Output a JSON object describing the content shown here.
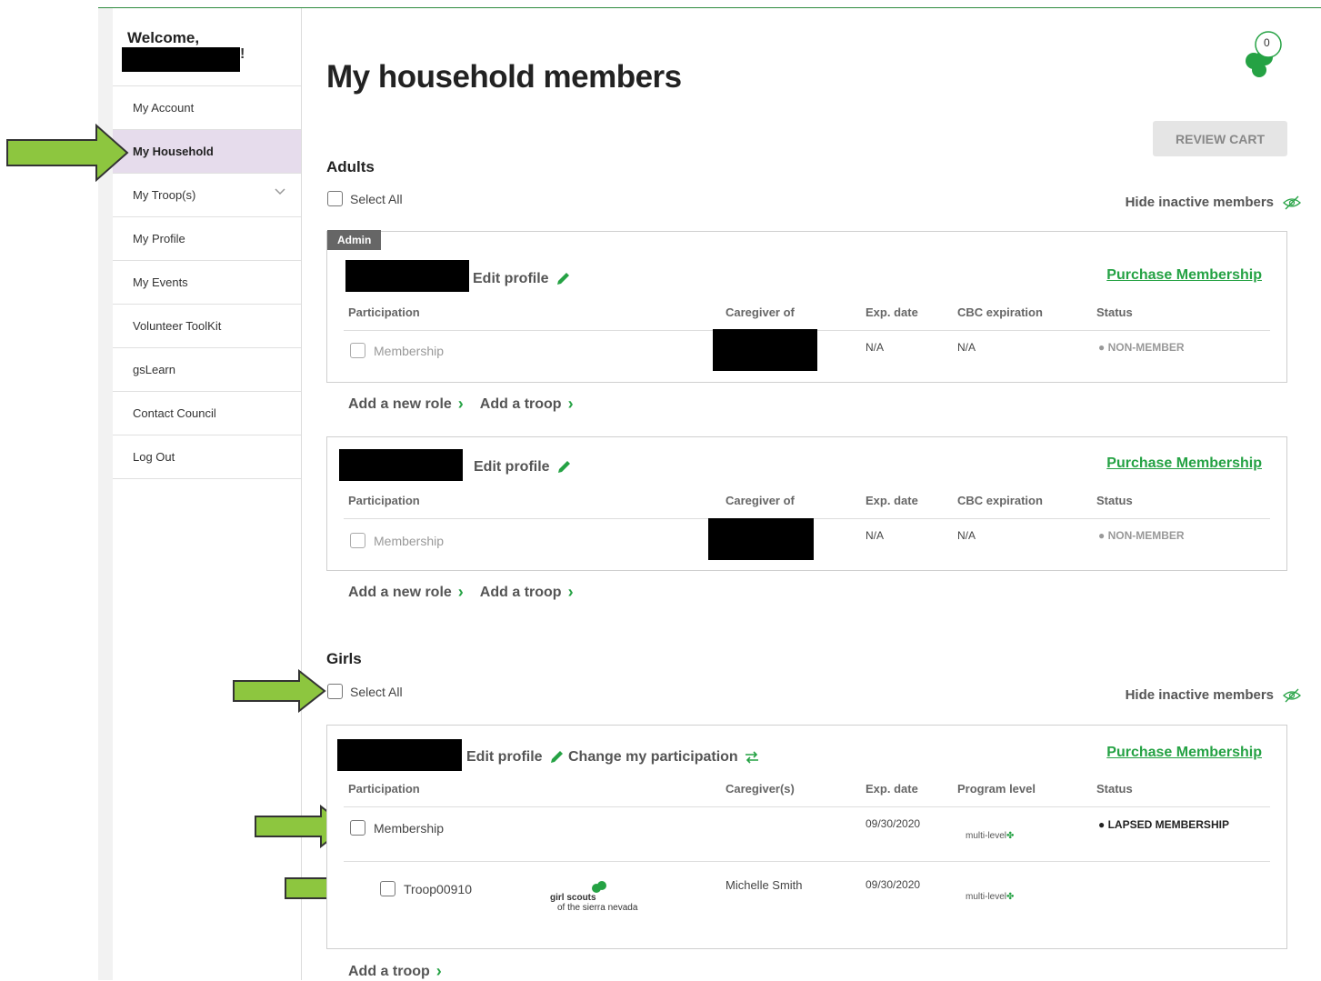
{
  "sidebar": {
    "welcome": "Welcome,",
    "welcome_suffix": "!",
    "items": [
      {
        "label": "My Account"
      },
      {
        "label": "My Household"
      },
      {
        "label": "My Troop(s)"
      },
      {
        "label": "My Profile"
      },
      {
        "label": "My Events"
      },
      {
        "label": "Volunteer ToolKit"
      },
      {
        "label": "gsLearn"
      },
      {
        "label": "Contact Council"
      },
      {
        "label": "Log Out"
      }
    ]
  },
  "header": {
    "title": "My household members",
    "cart_count": "0",
    "review_cart": "REVIEW CART"
  },
  "colors": {
    "accent": "#25a244",
    "arrow": "#8dc63f",
    "active_nav": "#e6dcec"
  },
  "adults": {
    "title": "Adults",
    "select_all": "Select All",
    "hide_inactive": "Hide inactive members",
    "admin_tag": "Admin",
    "cards": [
      {
        "edit_profile": "Edit profile",
        "purchase": "Purchase Membership",
        "headers": [
          "Participation",
          "Caregiver of",
          "Exp. date",
          "CBC expiration",
          "Status"
        ],
        "row": {
          "participation": "Membership",
          "exp": "N/A",
          "cbc": "N/A",
          "status": "NON-MEMBER"
        },
        "add_role": "Add a new role",
        "add_troop": "Add a troop"
      },
      {
        "edit_profile": "Edit profile",
        "purchase": "Purchase Membership",
        "headers": [
          "Participation",
          "Caregiver of",
          "Exp. date",
          "CBC expiration",
          "Status"
        ],
        "row": {
          "participation": "Membership",
          "exp": "N/A",
          "cbc": "N/A",
          "status": "NON-MEMBER"
        },
        "add_role": "Add a new role",
        "add_troop": "Add a troop"
      }
    ]
  },
  "girls": {
    "title": "Girls",
    "select_all": "Select All",
    "hide_inactive": "Hide inactive members",
    "card": {
      "edit_profile": "Edit profile",
      "change_participation": "Change my participation",
      "purchase": "Purchase Membership",
      "headers": [
        "Participation",
        "Caregiver(s)",
        "Exp. date",
        "Program level",
        "Status"
      ],
      "rows": [
        {
          "participation": "Membership",
          "caregiver": "",
          "exp": "09/30/2020",
          "level": "multi-level",
          "status": "LAPSED MEMBERSHIP"
        },
        {
          "participation": "Troop00910",
          "logo_line1": "girl scouts",
          "logo_line2": "of the sierra nevada",
          "caregiver": "Michelle Smith",
          "exp": "09/30/2020",
          "level": "multi-level",
          "status": ""
        }
      ],
      "add_troop": "Add a troop"
    }
  }
}
